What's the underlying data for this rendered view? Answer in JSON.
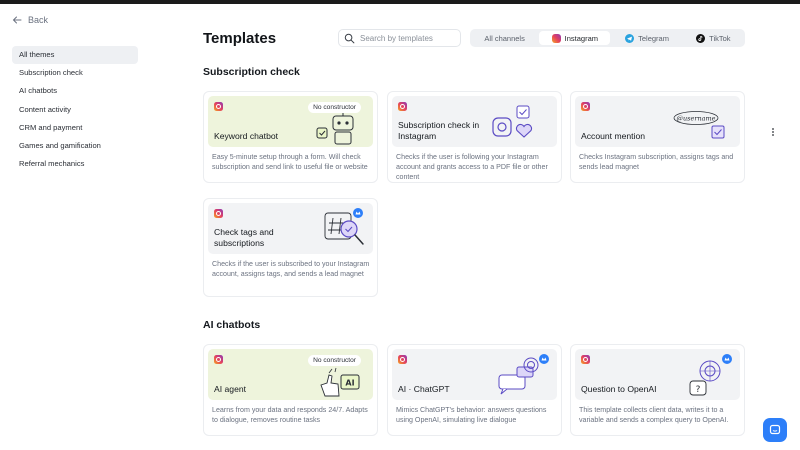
{
  "nav": {
    "back_label": "Back"
  },
  "sidebar": {
    "items": [
      {
        "label": "All themes"
      },
      {
        "label": "Subscription check"
      },
      {
        "label": "AI chatbots"
      },
      {
        "label": "Content activity"
      },
      {
        "label": "CRM and payment"
      },
      {
        "label": "Games and gamification"
      },
      {
        "label": "Referral mechanics"
      }
    ]
  },
  "header": {
    "title": "Templates",
    "search_placeholder": "Search by templates",
    "channels": [
      {
        "label": "All channels",
        "icon": ""
      },
      {
        "label": "Instagram",
        "icon": "instagram-icon"
      },
      {
        "label": "Telegram",
        "icon": "telegram-icon"
      },
      {
        "label": "TikTok",
        "icon": "tiktok-icon"
      }
    ],
    "active_channel": "Instagram"
  },
  "sections": [
    {
      "title": "Subscription check",
      "cards": [
        {
          "title": "Keyword chatbot",
          "badge": "No constructor",
          "description": "Easy 5-minute setup through a form. Will check subscription and send link to useful file or website"
        },
        {
          "title": "Subscription check in Instagram",
          "description": "Checks if the user is following your Instagram account and grants access to a PDF file or other content"
        },
        {
          "title": "Account mention",
          "art_text": "@username",
          "description": "Checks Instagram subscription, assigns tags and sends lead magnet"
        },
        {
          "title": "Check tags and subscriptions",
          "description": "Checks if the user is subscribed to your Instagram account, assigns tags, and sends a lead magnet"
        }
      ]
    },
    {
      "title": "AI chatbots",
      "cards": [
        {
          "title": "AI agent",
          "badge": "No constructor",
          "art_text": "AI",
          "description": "Learns from your data and responds 24/7. Adapts to dialogue, removes routine tasks"
        },
        {
          "title": "AI · ChatGPT",
          "description": "Mimics ChatGPT's behavior: answers questions using OpenAI, simulating live dialogue"
        },
        {
          "title": "Question to OpenAI",
          "art_text": "?",
          "description": "This template collects client data, writes it to a variable and sends a complex query to OpenAI."
        }
      ]
    }
  ],
  "colors": {
    "accent": "#2d7ff9",
    "green_banner": "#eef4dc",
    "art_purple": "#5b4bc4"
  }
}
